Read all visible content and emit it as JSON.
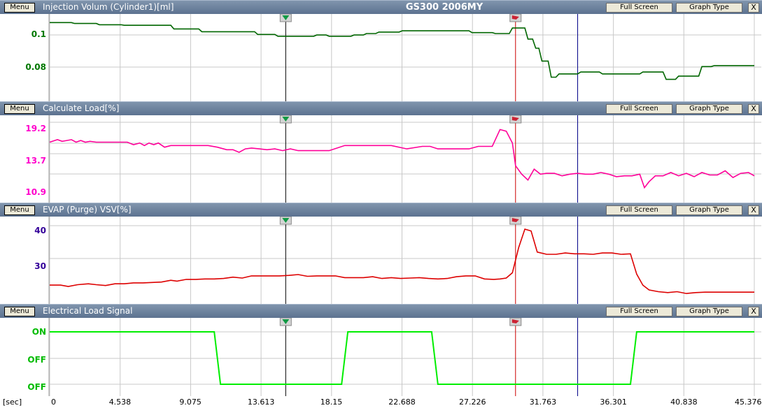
{
  "app_title": "GS300 2006MY",
  "buttons": {
    "menu": "Menu",
    "full_screen": "Full Screen",
    "graph_type": "Graph Type",
    "close": "X"
  },
  "x_axis": {
    "unit": "[sec]",
    "ticks": [
      "0",
      "4.538",
      "9.075",
      "13.613",
      "18.15",
      "22.688",
      "27.226",
      "31.763",
      "36.301",
      "40.838",
      "45.376"
    ]
  },
  "cursors": {
    "black_x": 15.2,
    "red_x": 30.0,
    "blue_x": 34.0
  },
  "colors": {
    "panel1": "#006600",
    "panel2": "#ff0099",
    "panel3": "#dd0000",
    "panel4": "#00ee00",
    "panel1_label": "#007700",
    "panel2_label": "#ff00cc",
    "panel3_label": "#330099",
    "panel4_label": "#00bb00"
  },
  "icons": {
    "cursor_marker": "green-down-arrow-icon",
    "flag_marker": "red-flag-icon"
  },
  "panels": [
    {
      "title": "Injection Volum (Cylinder1)[ml]",
      "y_labels": [
        "0.1",
        "0.08"
      ]
    },
    {
      "title": "Calculate Load[%]",
      "y_labels": [
        "19.2",
        "13.7",
        "10.9"
      ]
    },
    {
      "title": "EVAP (Purge) VSV[%]",
      "y_labels": [
        "40",
        "30"
      ]
    },
    {
      "title": "Electrical Load Signal",
      "y_labels": [
        "ON",
        "OFF",
        "OFF"
      ]
    }
  ],
  "chart_data": [
    {
      "type": "line",
      "title": "Injection Volum (Cylinder1)[ml]",
      "ylim": [
        0.064,
        0.104
      ],
      "x": [
        0,
        1.4,
        1.6,
        3.0,
        3.2,
        4.6,
        4.8,
        7.8,
        8.0,
        9.6,
        9.8,
        13.2,
        13.4,
        14.5,
        14.7,
        17.0,
        17.2,
        17.8,
        18.0,
        19.4,
        19.6,
        20.2,
        20.4,
        21.0,
        21.2,
        22.5,
        22.7,
        27.0,
        27.2,
        28.5,
        28.7,
        29.6,
        29.8,
        30.6,
        30.8,
        31.1,
        31.3,
        31.5,
        31.7,
        32.1,
        32.3,
        32.6,
        32.8,
        34.0,
        34.2,
        35.4,
        35.6,
        38.0,
        38.2,
        39.5,
        39.7,
        40.3,
        40.5,
        41.8,
        42.0,
        42.6,
        42.8,
        44.2,
        44.4,
        45.376
      ],
      "series": [
        {
          "values": [
            0.102,
            0.102,
            0.1015,
            0.1015,
            0.1008,
            0.1008,
            0.1005,
            0.1005,
            0.0985,
            0.0985,
            0.097,
            0.097,
            0.0955,
            0.0955,
            0.0945,
            0.0945,
            0.0952,
            0.0952,
            0.0945,
            0.0945,
            0.0952,
            0.0952,
            0.096,
            0.096,
            0.0968,
            0.0968,
            0.0975,
            0.0975,
            0.0965,
            0.0965,
            0.096,
            0.096,
            0.099,
            0.099,
            0.093,
            0.093,
            0.088,
            0.088,
            0.081,
            0.081,
            0.0722,
            0.0722,
            0.074,
            0.074,
            0.075,
            0.075,
            0.074,
            0.074,
            0.075,
            0.075,
            0.071,
            0.071,
            0.0728,
            0.0728,
            0.078,
            0.078,
            0.0785,
            0.0785,
            0.0785,
            0.0785
          ]
        }
      ]
    },
    {
      "type": "line",
      "title": "Calculate Load[%]",
      "ylim": [
        10.9,
        19.2
      ],
      "x": [
        0,
        0.5,
        0.8,
        1.1,
        1.4,
        1.7,
        2.0,
        2.3,
        2.6,
        3.0,
        3.5,
        4.0,
        4.5,
        5.0,
        5.4,
        5.8,
        6.1,
        6.4,
        6.7,
        7.0,
        7.4,
        7.8,
        8.3,
        9.0,
        9.6,
        10.2,
        10.8,
        11.4,
        11.8,
        12.2,
        12.6,
        13.0,
        13.5,
        14.0,
        14.5,
        15.0,
        15.5,
        16.0,
        17.0,
        18.0,
        19.0,
        20.0,
        21.0,
        22.0,
        23.0,
        24.0,
        24.5,
        25.0,
        25.5,
        26.0,
        27.0,
        27.6,
        28.0,
        28.5,
        29.0,
        29.4,
        29.8,
        30.0,
        30.4,
        30.8,
        31.2,
        31.6,
        32.0,
        32.5,
        33.0,
        33.5,
        34.0,
        34.5,
        35.0,
        35.5,
        36.0,
        36.5,
        37.0,
        37.5,
        38.0,
        38.3,
        38.6,
        39.0,
        39.5,
        40.0,
        40.5,
        41.0,
        41.5,
        42.0,
        42.5,
        43.0,
        43.5,
        44.0,
        44.5,
        45.0,
        45.376
      ],
      "series": [
        {
          "values": [
            17.0,
            17.3,
            17.1,
            17.2,
            17.3,
            17.0,
            17.2,
            17.0,
            17.1,
            17.0,
            17.0,
            17.0,
            17.0,
            17.0,
            16.7,
            16.9,
            16.6,
            16.9,
            16.7,
            16.9,
            16.4,
            16.6,
            16.6,
            16.6,
            16.6,
            16.6,
            16.4,
            16.1,
            16.1,
            15.8,
            16.2,
            16.3,
            16.2,
            16.1,
            16.2,
            16.0,
            16.2,
            16.0,
            16.0,
            16.0,
            16.6,
            16.6,
            16.6,
            16.6,
            16.2,
            16.5,
            16.5,
            16.2,
            16.2,
            16.2,
            16.2,
            16.5,
            16.5,
            16.5,
            18.5,
            18.3,
            16.9,
            14.2,
            13.2,
            12.5,
            13.8,
            13.2,
            13.3,
            13.3,
            13.0,
            13.2,
            13.3,
            13.2,
            13.2,
            13.4,
            13.2,
            12.9,
            13.0,
            13.0,
            13.2,
            11.6,
            12.3,
            13.0,
            13.0,
            13.4,
            13.0,
            13.3,
            12.9,
            13.4,
            13.1,
            13.1,
            13.6,
            12.8,
            13.3,
            13.4,
            13.0
          ]
        }
      ]
    },
    {
      "type": "line",
      "title": "EVAP (Purge) VSV[%]",
      "ylim": [
        23.5,
        40
      ],
      "x": [
        0,
        0.7,
        1.2,
        1.8,
        2.5,
        3.0,
        3.6,
        4.2,
        4.8,
        5.4,
        6.0,
        6.6,
        7.2,
        7.8,
        8.2,
        8.8,
        9.4,
        10.0,
        10.6,
        11.2,
        11.8,
        12.4,
        13.0,
        13.6,
        14.2,
        14.8,
        15.4,
        16.0,
        16.6,
        17.2,
        17.8,
        18.4,
        19.0,
        19.6,
        20.2,
        20.8,
        21.4,
        22.0,
        22.6,
        23.2,
        23.8,
        24.4,
        25.0,
        25.6,
        26.2,
        26.8,
        27.4,
        28.0,
        28.6,
        29.0,
        29.4,
        29.8,
        30.2,
        30.6,
        31.0,
        31.4,
        32.0,
        32.6,
        33.2,
        33.8,
        34.4,
        35.0,
        35.6,
        36.2,
        36.8,
        37.4,
        37.8,
        38.2,
        38.6,
        39.2,
        39.8,
        40.4,
        41.0,
        41.6,
        42.2,
        42.8,
        43.4,
        44.0,
        44.6,
        45.376
      ],
      "series": [
        {
          "values": [
            26.5,
            26.5,
            26.2,
            26.6,
            26.8,
            26.6,
            26.4,
            26.8,
            26.8,
            27.0,
            27.0,
            27.1,
            27.2,
            27.6,
            27.4,
            27.8,
            27.8,
            27.9,
            27.9,
            28.0,
            28.3,
            28.1,
            28.6,
            28.6,
            28.6,
            28.6,
            28.7,
            28.9,
            28.5,
            28.6,
            28.6,
            28.6,
            28.2,
            28.2,
            28.2,
            28.4,
            28.0,
            28.2,
            28.0,
            28.1,
            28.2,
            28.0,
            27.9,
            28.0,
            28.4,
            28.6,
            28.6,
            27.9,
            27.8,
            27.9,
            28.1,
            29.3,
            35.0,
            39.2,
            38.8,
            34.0,
            33.5,
            33.5,
            33.8,
            33.6,
            33.6,
            33.5,
            33.8,
            33.8,
            33.5,
            33.6,
            29.0,
            26.5,
            25.4,
            25.0,
            24.8,
            25.0,
            24.6,
            24.8,
            24.9,
            24.9,
            24.9,
            24.9,
            24.9,
            24.9
          ]
        }
      ]
    },
    {
      "type": "line",
      "title": "Electrical Load Signal",
      "ylim": [
        0,
        1
      ],
      "x": [
        0,
        10.6,
        11.0,
        18.8,
        19.2,
        24.6,
        25.0,
        37.4,
        37.8,
        45.376
      ],
      "series": [
        {
          "values": [
            1,
            1,
            0,
            0,
            1,
            1,
            0,
            0,
            1,
            1
          ]
        }
      ]
    }
  ]
}
